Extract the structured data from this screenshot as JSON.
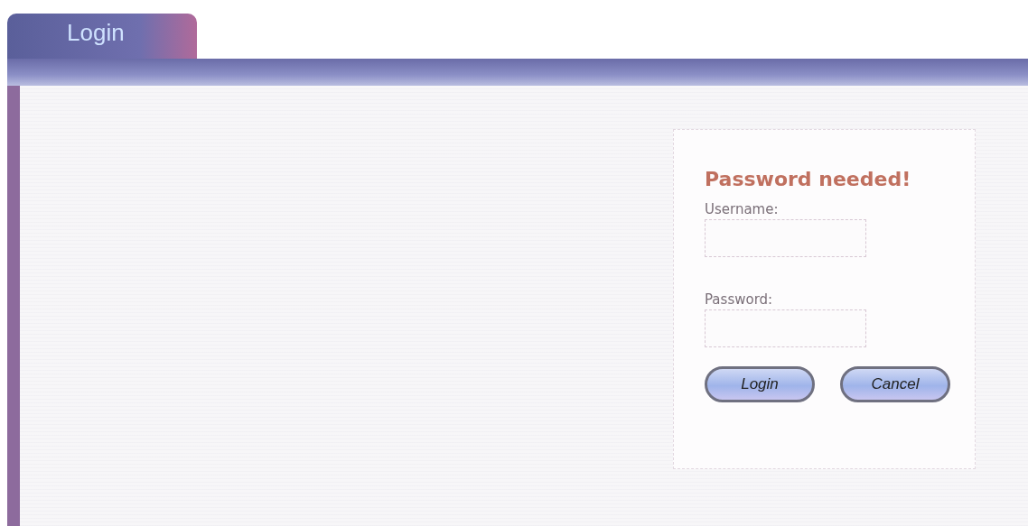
{
  "tab": {
    "label": "Login",
    "selected": true
  },
  "login_form": {
    "title": "Password needed!",
    "fields": [
      {
        "label": "Username:"
      },
      {
        "label": "Password:"
      }
    ],
    "buttons": [
      "Login",
      "Cancel"
    ]
  }
}
